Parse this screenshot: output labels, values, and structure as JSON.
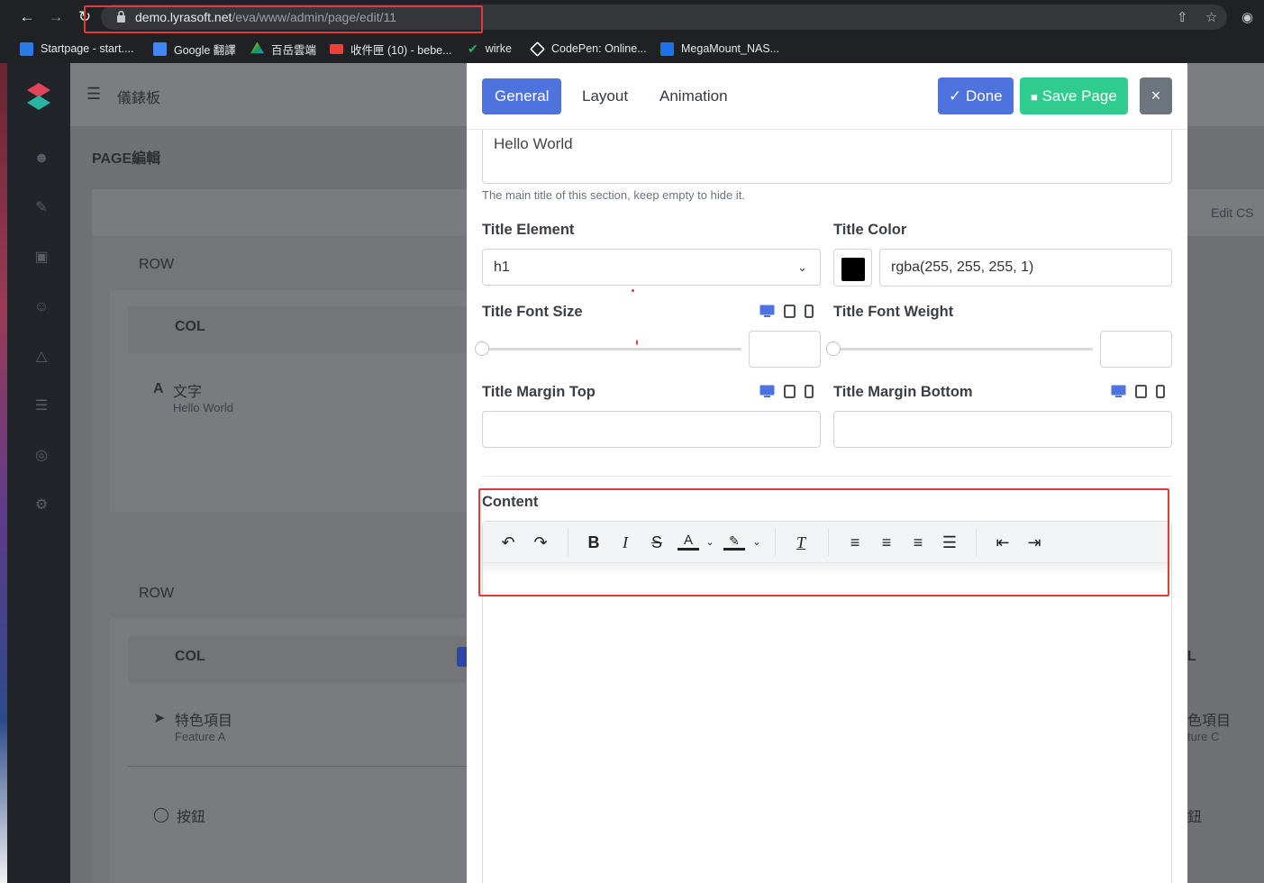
{
  "browser": {
    "url_host": "demo.lyrasoft.net",
    "url_path": "/eva/www/admin/page/edit/11",
    "bookmarks": [
      {
        "label": "Startpage - start....",
        "icon": "startpage-icon",
        "color": "#2c7be5"
      },
      {
        "label": "Google 翻譯",
        "icon": "google-translate-icon",
        "color": "#4285f4"
      },
      {
        "label": "百岳雲端",
        "icon": "google-drive-icon",
        "color": "#0f9d58"
      },
      {
        "label": "收件匣 (10) - bebe...",
        "icon": "gmail-icon",
        "color": "#ea4335"
      },
      {
        "label": "wirke",
        "icon": "checkmark-icon",
        "color": "#1db954"
      },
      {
        "label": "CodePen: Online...",
        "icon": "codepen-icon",
        "color": "#ffffff"
      },
      {
        "label": "MegaMount_NAS...",
        "icon": "dsm-icon",
        "color": "#1a73e8"
      }
    ]
  },
  "background": {
    "breadcrumb": "儀錶板",
    "page_title": "PAGE編輯",
    "row1": "ROW",
    "col1": "COL",
    "text_addon": "文字",
    "text_addon_sub": "Hello World",
    "row2": "ROW",
    "col2": "COL",
    "feature_addon": "特色項目",
    "feature_sub": "Feature A",
    "button_addon": "按鈕",
    "right_feature": "色項目",
    "right_feature_sub": "ture C",
    "right_button": "鈕",
    "right_col": "L",
    "edit_css": "Edit CS"
  },
  "modal": {
    "tabs": [
      "General",
      "Layout",
      "Animation"
    ],
    "done_label": "Done",
    "save_label": "Save Page",
    "close_label": "×",
    "title_value": "Hello World",
    "title_help": "The main title of this section, keep empty to hide it.",
    "title_element_label": "Title Element",
    "title_element_value": "h1",
    "title_color_label": "Title Color",
    "title_color_value": "rgba(255, 255, 255, 1)",
    "title_color_swatch": "#000000",
    "title_font_size_label": "Title Font Size",
    "title_font_weight_label": "Title Font Weight",
    "title_margin_top_label": "Title Margin Top",
    "title_margin_bottom_label": "Title Margin Bottom",
    "content_label": "Content"
  },
  "colors": {
    "accent": "#4e73df",
    "success": "#2ecc8f",
    "secondary": "#6c757d",
    "highlight": "#e53935"
  }
}
